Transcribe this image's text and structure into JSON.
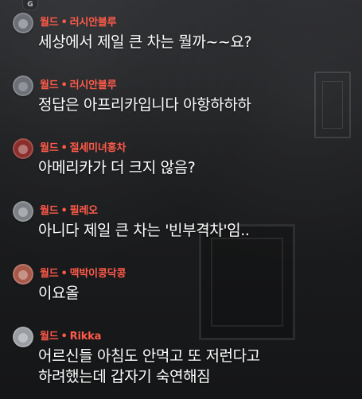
{
  "messages": [
    {
      "rank": "월드",
      "user": "러시안블루",
      "text": "세상에서 제일 큰 차는 뭘까~~요?"
    },
    {
      "rank": "월드",
      "user": "러시안블루",
      "text": "정답은 아프리카입니다 아항하하하"
    },
    {
      "rank": "월드",
      "user": "절세미녀홍차",
      "text": "아메리카가 더 크지 않음?"
    },
    {
      "rank": "월드",
      "user": "필레오",
      "text": "아니다 제일 큰 차는 '빈부격차'임.."
    },
    {
      "rank": "월드",
      "user": "맥박이콩닥콩",
      "text": "이요올"
    },
    {
      "rank": "월드",
      "user": "Rikka",
      "text_line1": "어르신들 아침도 안먹고 또 저런다고",
      "text_line2": "하려했는데 갑자기 숙연해짐"
    }
  ],
  "ui": {
    "separator": "•",
    "top_chip": "G"
  },
  "colors": {
    "name": "#ff5a4a",
    "text": "#ffffff",
    "background": "#1b1c1e"
  },
  "icons": {
    "avatar": "user-avatar-icon",
    "chip": "g-chip-icon"
  }
}
